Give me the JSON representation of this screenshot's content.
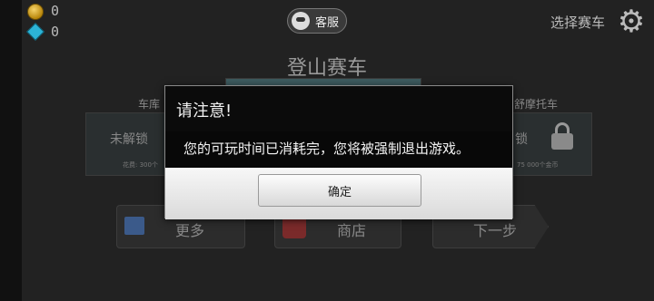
{
  "hud": {
    "coins": "0",
    "gems": "0"
  },
  "header": {
    "service_label": "客服",
    "select_vehicle_label": "选择赛车",
    "title": "登山赛车"
  },
  "vehicles": {
    "left_label": "车库",
    "right_label": "舒摩托车",
    "left_status": "未解锁",
    "left_price": "花费: 300个",
    "right_status": "锁",
    "right_price": "75 000个金币"
  },
  "buttons": {
    "more": "更多",
    "shop": "商店",
    "next": "下一步"
  },
  "dialog": {
    "title": "请注意!",
    "message": "您的可玩时间已消耗完，您将被强制退出游戏。",
    "ok_label": "确定"
  },
  "colors": {
    "dialog_header": "#0b0b0b",
    "dialog_footer": "#e6e6e6",
    "background": "#222222"
  }
}
